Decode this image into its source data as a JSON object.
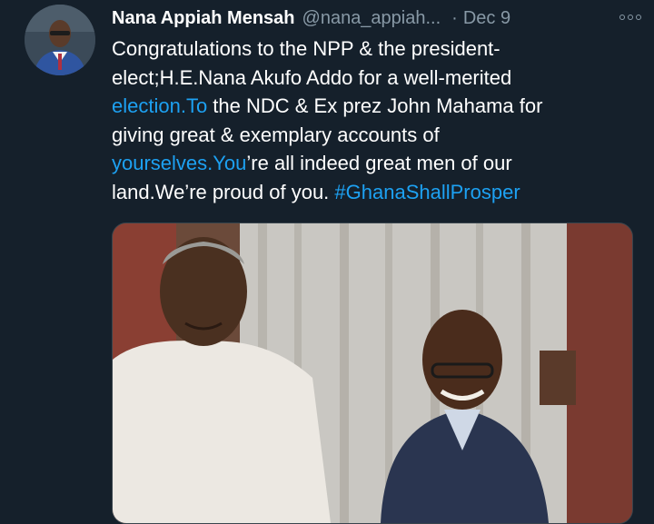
{
  "tweet": {
    "author_name": "Nana Appiah Mensah",
    "handle": "@nana_appiah...",
    "separator": "·",
    "date": "Dec 9",
    "more_icon": "more-options-icon",
    "lines": [
      [
        {
          "text": "Congratulations to the NPP & the president-",
          "link": false
        }
      ],
      [
        {
          "text": "elect;H.E.Nana Akufo Addo for a well-merited",
          "link": false
        }
      ],
      [
        {
          "text": "election.To",
          "link": true
        },
        {
          "text": " the NDC & Ex prez John Mahama for",
          "link": false
        }
      ],
      [
        {
          "text": "giving great & exemplary accounts of",
          "link": false
        }
      ],
      [
        {
          "text": "yourselves.You",
          "link": true
        },
        {
          "text": "’re all indeed great men of our",
          "link": false
        }
      ],
      [
        {
          "text": "land.We’re proud of you. ",
          "link": false
        },
        {
          "text": "#GhanaShallProsper",
          "link": true
        }
      ]
    ]
  },
  "colors": {
    "background": "#15202b",
    "link": "#1da1f2",
    "muted": "#8899a6"
  }
}
